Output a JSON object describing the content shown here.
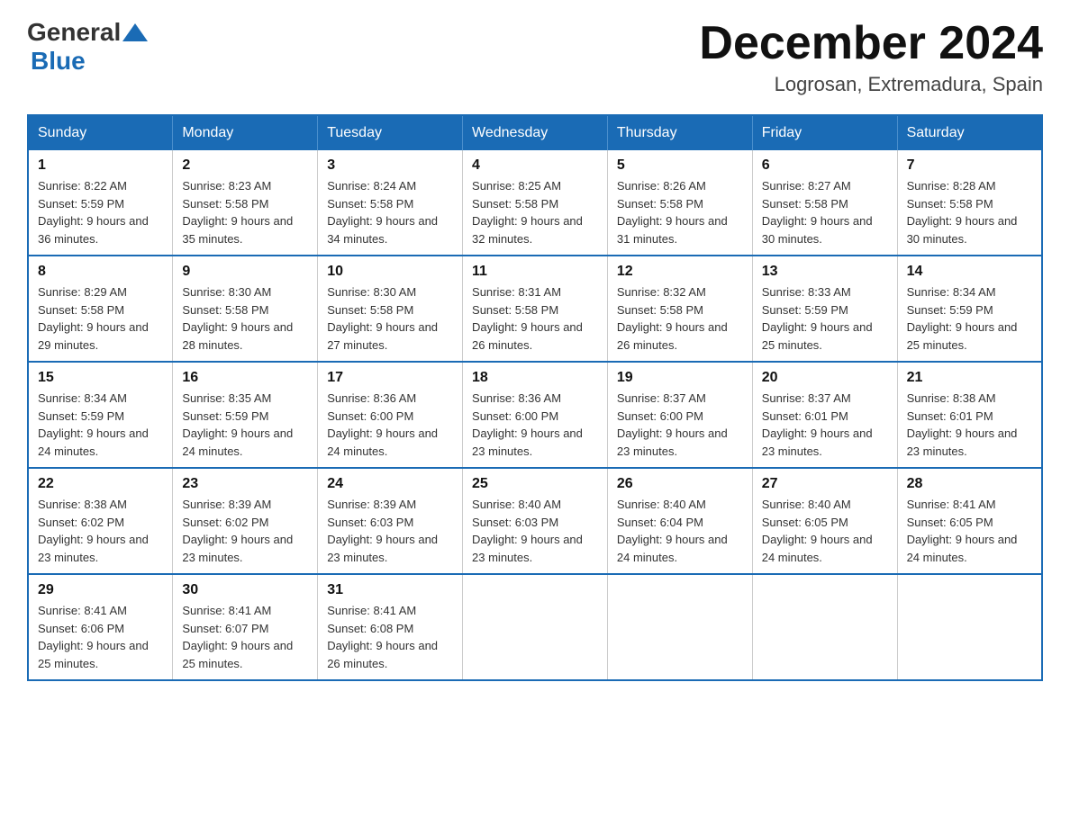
{
  "logo": {
    "text_general": "General",
    "text_blue": "Blue",
    "arrow_desc": "blue arrow logo"
  },
  "title": "December 2024",
  "location": "Logrosan, Extremadura, Spain",
  "days_of_week": [
    "Sunday",
    "Monday",
    "Tuesday",
    "Wednesday",
    "Thursday",
    "Friday",
    "Saturday"
  ],
  "weeks": [
    [
      {
        "day": "1",
        "sunrise": "8:22 AM",
        "sunset": "5:59 PM",
        "daylight": "9 hours and 36 minutes."
      },
      {
        "day": "2",
        "sunrise": "8:23 AM",
        "sunset": "5:58 PM",
        "daylight": "9 hours and 35 minutes."
      },
      {
        "day": "3",
        "sunrise": "8:24 AM",
        "sunset": "5:58 PM",
        "daylight": "9 hours and 34 minutes."
      },
      {
        "day": "4",
        "sunrise": "8:25 AM",
        "sunset": "5:58 PM",
        "daylight": "9 hours and 32 minutes."
      },
      {
        "day": "5",
        "sunrise": "8:26 AM",
        "sunset": "5:58 PM",
        "daylight": "9 hours and 31 minutes."
      },
      {
        "day": "6",
        "sunrise": "8:27 AM",
        "sunset": "5:58 PM",
        "daylight": "9 hours and 30 minutes."
      },
      {
        "day": "7",
        "sunrise": "8:28 AM",
        "sunset": "5:58 PM",
        "daylight": "9 hours and 30 minutes."
      }
    ],
    [
      {
        "day": "8",
        "sunrise": "8:29 AM",
        "sunset": "5:58 PM",
        "daylight": "9 hours and 29 minutes."
      },
      {
        "day": "9",
        "sunrise": "8:30 AM",
        "sunset": "5:58 PM",
        "daylight": "9 hours and 28 minutes."
      },
      {
        "day": "10",
        "sunrise": "8:30 AM",
        "sunset": "5:58 PM",
        "daylight": "9 hours and 27 minutes."
      },
      {
        "day": "11",
        "sunrise": "8:31 AM",
        "sunset": "5:58 PM",
        "daylight": "9 hours and 26 minutes."
      },
      {
        "day": "12",
        "sunrise": "8:32 AM",
        "sunset": "5:58 PM",
        "daylight": "9 hours and 26 minutes."
      },
      {
        "day": "13",
        "sunrise": "8:33 AM",
        "sunset": "5:59 PM",
        "daylight": "9 hours and 25 minutes."
      },
      {
        "day": "14",
        "sunrise": "8:34 AM",
        "sunset": "5:59 PM",
        "daylight": "9 hours and 25 minutes."
      }
    ],
    [
      {
        "day": "15",
        "sunrise": "8:34 AM",
        "sunset": "5:59 PM",
        "daylight": "9 hours and 24 minutes."
      },
      {
        "day": "16",
        "sunrise": "8:35 AM",
        "sunset": "5:59 PM",
        "daylight": "9 hours and 24 minutes."
      },
      {
        "day": "17",
        "sunrise": "8:36 AM",
        "sunset": "6:00 PM",
        "daylight": "9 hours and 24 minutes."
      },
      {
        "day": "18",
        "sunrise": "8:36 AM",
        "sunset": "6:00 PM",
        "daylight": "9 hours and 23 minutes."
      },
      {
        "day": "19",
        "sunrise": "8:37 AM",
        "sunset": "6:00 PM",
        "daylight": "9 hours and 23 minutes."
      },
      {
        "day": "20",
        "sunrise": "8:37 AM",
        "sunset": "6:01 PM",
        "daylight": "9 hours and 23 minutes."
      },
      {
        "day": "21",
        "sunrise": "8:38 AM",
        "sunset": "6:01 PM",
        "daylight": "9 hours and 23 minutes."
      }
    ],
    [
      {
        "day": "22",
        "sunrise": "8:38 AM",
        "sunset": "6:02 PM",
        "daylight": "9 hours and 23 minutes."
      },
      {
        "day": "23",
        "sunrise": "8:39 AM",
        "sunset": "6:02 PM",
        "daylight": "9 hours and 23 minutes."
      },
      {
        "day": "24",
        "sunrise": "8:39 AM",
        "sunset": "6:03 PM",
        "daylight": "9 hours and 23 minutes."
      },
      {
        "day": "25",
        "sunrise": "8:40 AM",
        "sunset": "6:03 PM",
        "daylight": "9 hours and 23 minutes."
      },
      {
        "day": "26",
        "sunrise": "8:40 AM",
        "sunset": "6:04 PM",
        "daylight": "9 hours and 24 minutes."
      },
      {
        "day": "27",
        "sunrise": "8:40 AM",
        "sunset": "6:05 PM",
        "daylight": "9 hours and 24 minutes."
      },
      {
        "day": "28",
        "sunrise": "8:41 AM",
        "sunset": "6:05 PM",
        "daylight": "9 hours and 24 minutes."
      }
    ],
    [
      {
        "day": "29",
        "sunrise": "8:41 AM",
        "sunset": "6:06 PM",
        "daylight": "9 hours and 25 minutes."
      },
      {
        "day": "30",
        "sunrise": "8:41 AM",
        "sunset": "6:07 PM",
        "daylight": "9 hours and 25 minutes."
      },
      {
        "day": "31",
        "sunrise": "8:41 AM",
        "sunset": "6:08 PM",
        "daylight": "9 hours and 26 minutes."
      },
      null,
      null,
      null,
      null
    ]
  ],
  "labels": {
    "sunrise": "Sunrise:",
    "sunset": "Sunset:",
    "daylight": "Daylight:"
  }
}
